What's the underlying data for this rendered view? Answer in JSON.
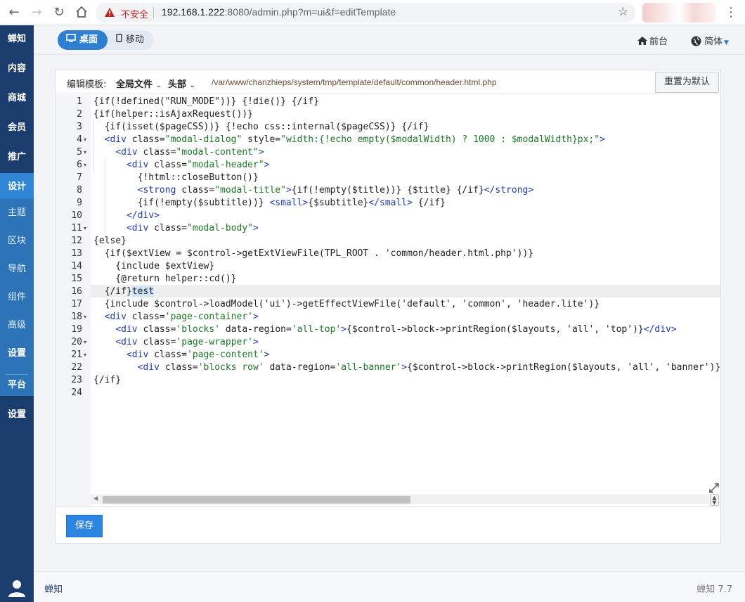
{
  "browser": {
    "security_label": "不安全",
    "url_host": "192.168.1.222",
    "url_rest": ":8080/admin.php?m=ui&f=editTemplate"
  },
  "sidebar": {
    "items": [
      {
        "label": "蝉知"
      },
      {
        "label": "内容"
      },
      {
        "label": "商城"
      },
      {
        "label": "会员"
      },
      {
        "label": "推广"
      },
      {
        "label": "设计"
      },
      {
        "label": "主题"
      },
      {
        "label": "区块"
      },
      {
        "label": "导航"
      },
      {
        "label": "组件"
      },
      {
        "label": "高级"
      },
      {
        "label": "设置"
      },
      {
        "label": "平台"
      },
      {
        "label": "设置"
      }
    ],
    "active": "设计",
    "selected_sub": "设置"
  },
  "topbar": {
    "desktop_label": "桌面",
    "mobile_label": "移动",
    "front_label": "前台",
    "lang_label": "简体"
  },
  "panel": {
    "edit_label": "编辑模板:",
    "file_dropdown": "全局文件",
    "section_dropdown": "头部",
    "path": "/var/www/chanzhieps/system/tmp/template/default/common/header.html.php",
    "reset_label": "重置为默认",
    "save_label": "保存"
  },
  "editor": {
    "line_numbers": [
      "1",
      "2",
      "3",
      "4",
      "5",
      "6",
      "7",
      "8",
      "9",
      "10",
      "11",
      "12",
      "13",
      "14",
      "15",
      "16",
      "17",
      "18",
      "19",
      "20",
      "21",
      "22",
      "23",
      "24"
    ],
    "current_line": 16
  },
  "footer": {
    "brand": "蝉知",
    "version": "蝉知 7.7"
  },
  "colors": {
    "sidebar": "#1b3d6e",
    "sidebar_active": "#2f86d6",
    "primary": "#2c85e0",
    "code_string": "#1a7a24",
    "code_tag": "#1f3bbf"
  }
}
